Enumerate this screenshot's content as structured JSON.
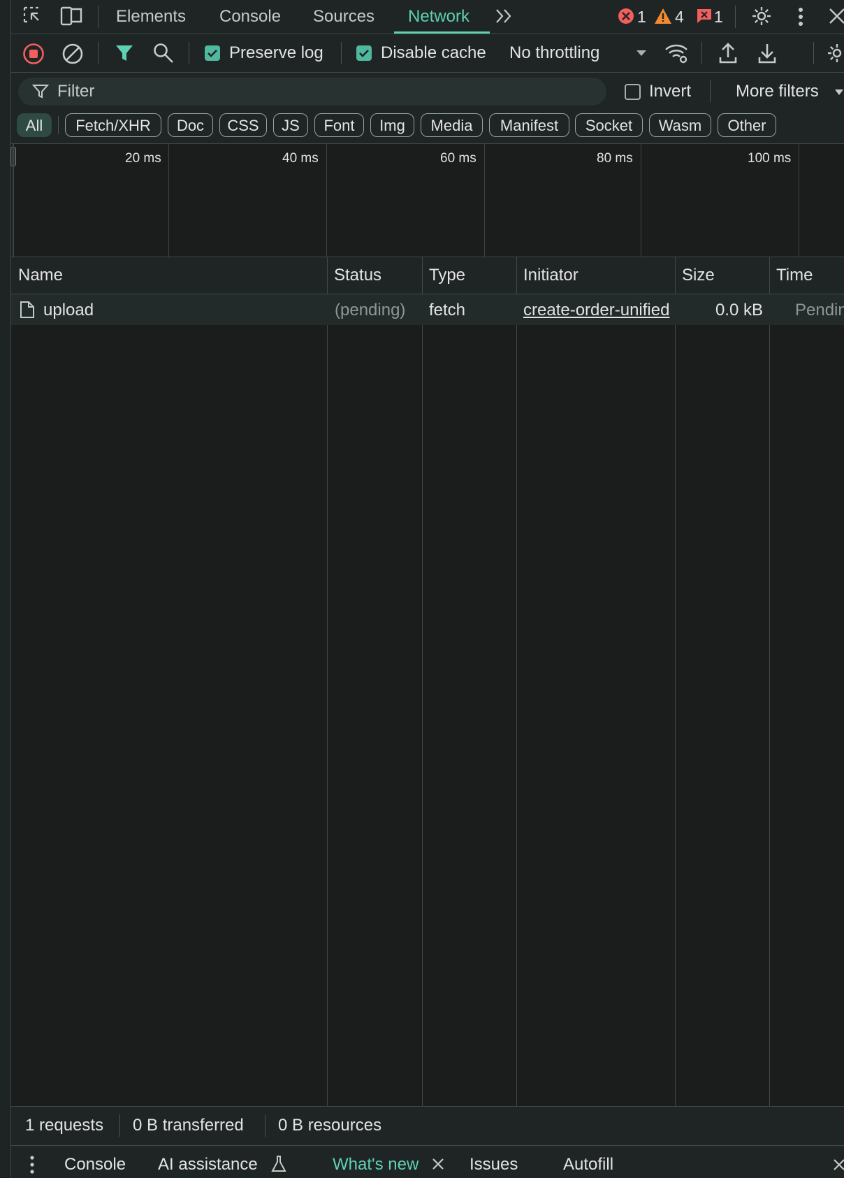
{
  "tabs": [
    {
      "label": "Elements"
    },
    {
      "label": "Console"
    },
    {
      "label": "Sources"
    },
    {
      "label": "Network",
      "active": true
    }
  ],
  "badges": {
    "errors": "1",
    "warnings": "4",
    "issues": "1"
  },
  "toolbar": {
    "preserve_log": "Preserve log",
    "preserve_log_checked": true,
    "disable_cache": "Disable cache",
    "disable_cache_checked": true,
    "throttling": "No throttling"
  },
  "filter": {
    "placeholder": "Filter",
    "invert": "Invert",
    "invert_checked": false,
    "more_filters": "More filters"
  },
  "type_filters": [
    "All",
    "Fetch/XHR",
    "Doc",
    "CSS",
    "JS",
    "Font",
    "Img",
    "Media",
    "Manifest",
    "Socket",
    "Wasm",
    "Other"
  ],
  "type_filter_active": "All",
  "overview": {
    "ticks": [
      "20 ms",
      "40 ms",
      "60 ms",
      "80 ms",
      "100 ms"
    ]
  },
  "table": {
    "columns": [
      "Name",
      "Status",
      "Type",
      "Initiator",
      "Size",
      "Time"
    ],
    "rows": [
      {
        "name": "upload",
        "status": "(pending)",
        "type": "fetch",
        "initiator": "create-order-unified",
        "size": "0.0 kB",
        "time": "Pending"
      }
    ]
  },
  "summary": {
    "requests": "1 requests",
    "transferred": "0 B transferred",
    "resources": "0 B resources"
  },
  "drawer": {
    "tabs": [
      "Console",
      "AI assistance",
      "What's new",
      "Issues",
      "Autofill"
    ],
    "active": "What's new"
  },
  "colors": {
    "accent": "#5fd0b3",
    "record": "#f25f5c",
    "warning": "#f28b30",
    "background": "#1a1d1c"
  }
}
